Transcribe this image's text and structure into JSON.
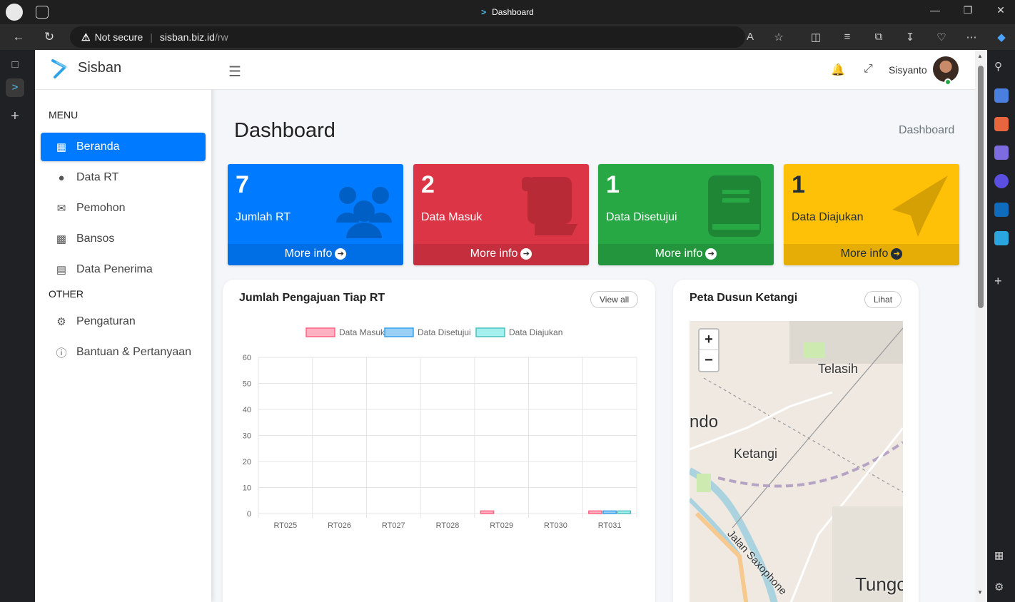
{
  "browser": {
    "tab_title": "Dashboard",
    "security_label": "Not secure",
    "url_domain": "sisban.biz.id",
    "url_path": "/rw"
  },
  "sidebar": {
    "brand": "Sisban",
    "menu_heading": "MENU",
    "menu_items": [
      {
        "label": "Beranda",
        "icon": "calendar-icon",
        "active": true
      },
      {
        "label": "Data RT",
        "icon": "users-icon"
      },
      {
        "label": "Pemohon",
        "icon": "envelope-icon"
      },
      {
        "label": "Bansos",
        "icon": "boxes-icon"
      },
      {
        "label": "Data Penerima",
        "icon": "book-icon"
      }
    ],
    "other_heading": "OTHER",
    "other_items": [
      {
        "label": "Pengaturan",
        "icon": "gear-icon"
      },
      {
        "label": "Bantuan & Pertanyaan",
        "icon": "question-icon"
      }
    ]
  },
  "header": {
    "username": "Sisyanto"
  },
  "main": {
    "page_title": "Dashboard",
    "breadcrumb": "Dashboard",
    "stat_boxes": [
      {
        "value": "7",
        "label": "Jumlah RT",
        "link": "More info",
        "color": "#007bff",
        "icon": "users-icon"
      },
      {
        "value": "2",
        "label": "Data Masuk",
        "link": "More info",
        "color": "#dc3545",
        "icon": "scroll-icon"
      },
      {
        "value": "1",
        "label": "Data Disetujui",
        "link": "More info",
        "color": "#28a745",
        "icon": "book-icon"
      },
      {
        "value": "1",
        "label": "Data Diajukan",
        "link": "More info",
        "color": "#ffc107",
        "icon": "paper-plane-icon"
      }
    ],
    "chart_card": {
      "title": "Jumlah Pengajuan Tiap RT",
      "button": "View all"
    },
    "map_card": {
      "title": "Peta Dusun Ketangi",
      "button": "Lihat",
      "zoom_in": "+",
      "zoom_out": "−",
      "labels": [
        "Telasih",
        "ndo",
        "Ketangi",
        "Jalan Saxophone",
        "Tungc"
      ]
    }
  },
  "chart_data": {
    "type": "bar",
    "categories": [
      "RT025",
      "RT026",
      "RT027",
      "RT028",
      "RT029",
      "RT030",
      "RT031"
    ],
    "series": [
      {
        "name": "Data Masuk",
        "values": [
          0,
          0,
          0,
          0,
          1,
          0,
          1
        ],
        "fill": "#ffb1c1",
        "stroke": "#ff6384"
      },
      {
        "name": "Data Disetujui",
        "values": [
          0,
          0,
          0,
          0,
          0,
          0,
          1
        ],
        "fill": "#9ad0f5",
        "stroke": "#36a2eb"
      },
      {
        "name": "Data Diajukan",
        "values": [
          0,
          0,
          0,
          0,
          0,
          0,
          1
        ],
        "fill": "#a5f0ec",
        "stroke": "#4bc0c0"
      }
    ],
    "yticks": [
      0,
      10,
      20,
      30,
      40,
      50,
      60
    ],
    "ylim": [
      0,
      60
    ],
    "legend": "top",
    "grid": true
  }
}
